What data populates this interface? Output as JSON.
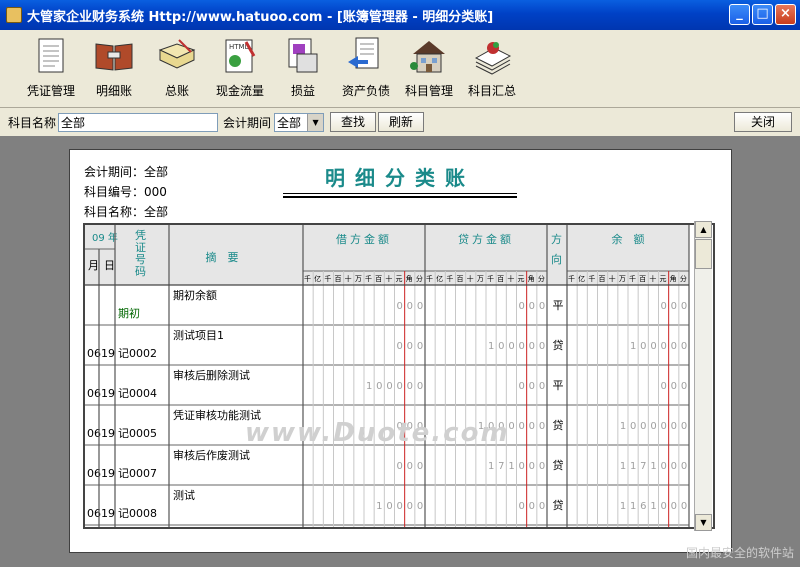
{
  "window": {
    "title": "大管家企业财务系统 Http://www.hatuoo.com - [账簿管理器 - 明细分类账]"
  },
  "toolbar": {
    "items": [
      {
        "label": "凭证管理",
        "icon": "voucher-doc-icon"
      },
      {
        "label": "明细账",
        "icon": "open-book-icon"
      },
      {
        "label": "总账",
        "icon": "ledger-book-icon"
      },
      {
        "label": "现金流量",
        "icon": "html-page-icon"
      },
      {
        "label": "损益",
        "icon": "printer-page-icon"
      },
      {
        "label": "资产负债",
        "icon": "balance-sheet-icon"
      },
      {
        "label": "科目管理",
        "icon": "house-icon"
      },
      {
        "label": "科目汇总",
        "icon": "stacked-papers-icon"
      }
    ]
  },
  "filter": {
    "subject_label": "科目名称",
    "subject_value": "全部",
    "period_label": "会计期间",
    "period_value": "全部",
    "find_label": "查找",
    "refresh_label": "刷新",
    "close_label": "关闭"
  },
  "ledger": {
    "title": "明细分类账",
    "period": "会计期间：全部",
    "code": "科目编号：000",
    "name": "科目名称：全部",
    "headers": {
      "year": "09 年",
      "month": "月",
      "day": "日",
      "voucher": "凭证号码",
      "summary": "摘　要",
      "debit": "借方金额",
      "credit": "贷方金额",
      "direction": "方向",
      "balance": "余　额"
    },
    "digits": [
      "千",
      "亿",
      "千",
      "百",
      "十",
      "万",
      "千",
      "百",
      "十",
      "元",
      "角",
      "分"
    ],
    "rows": [
      {
        "month": "",
        "day": "",
        "voucher": "期初",
        "summary": "期初余额",
        "debit": "000",
        "credit": "000",
        "dir": "平",
        "balance": "000"
      },
      {
        "month": "06",
        "day": "19",
        "voucher": "记0002",
        "summary": "测试项目1",
        "debit": "000",
        "credit": "100000",
        "dir": "贷",
        "balance": "100000"
      },
      {
        "month": "06",
        "day": "19",
        "voucher": "记0004",
        "summary": "审核后删除测试",
        "debit": "100000",
        "credit": "000",
        "dir": "平",
        "balance": "000"
      },
      {
        "month": "06",
        "day": "19",
        "voucher": "记0005",
        "summary": "凭证审核功能测试",
        "debit": "000",
        "credit": "1000000",
        "dir": "贷",
        "balance": "1000000"
      },
      {
        "month": "06",
        "day": "19",
        "voucher": "记0007",
        "summary": "审核后作废测试",
        "debit": "000",
        "credit": "171000",
        "dir": "贷",
        "balance": "1171000"
      },
      {
        "month": "06",
        "day": "19",
        "voucher": "记0008",
        "summary": "测试",
        "debit": "10000",
        "credit": "000",
        "dir": "贷",
        "balance": "1161000"
      }
    ]
  },
  "watermark": {
    "main": "www.Duote.com",
    "corner": "国内最安全的软件站"
  },
  "colors": {
    "title_teal": "#1a8a8a",
    "red_line": "#cc2222",
    "grid_line": "#c8c8c8",
    "voucher_green": "#006600"
  }
}
